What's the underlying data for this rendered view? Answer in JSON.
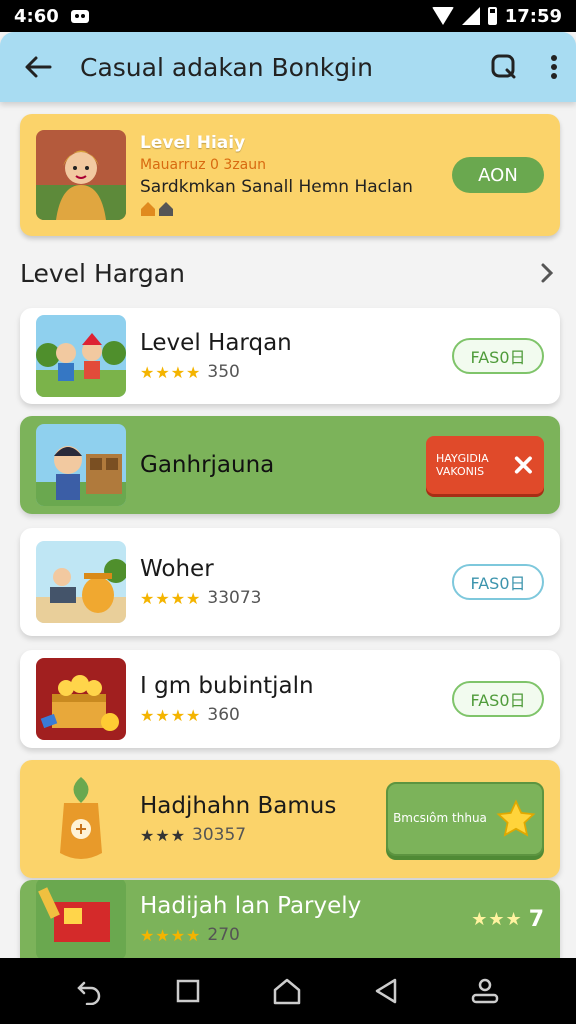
{
  "status_bar": {
    "time_left": "4:60",
    "time_right": "17:59"
  },
  "app_bar": {
    "title": "Casual adakan Bonkgin"
  },
  "banner": {
    "title": "Level Hiaiy",
    "subtitle": "Mauarruz 0 3zaun",
    "description": "Sardkmkan Sanall Hemn Haclan",
    "button_label": "AON"
  },
  "section": {
    "title": "Level Hargan"
  },
  "items": [
    {
      "name": "Level Harqan",
      "stars": "★★★★",
      "count": "350",
      "button_label": "FAS0日"
    },
    {
      "name": "Ganhrjauna",
      "button_label": "HAYGIDIA VAKONIS"
    },
    {
      "name": "Woher",
      "stars": "★★★★",
      "count": "33073",
      "button_label": "FAS0日"
    },
    {
      "name": "I gm bubintjaln",
      "stars": "★★★★",
      "count": "360",
      "button_label": "FAS0日"
    },
    {
      "name": "Hadjhahn Bamus",
      "stars": "★★★",
      "count": "30357",
      "button_label": "Bmcsıôm thhua"
    },
    {
      "name": "Hadijah lan Paryely",
      "stars": "★★★★",
      "count": "270",
      "rating": "7"
    }
  ],
  "colors": {
    "accent_blue": "#a8dcf2",
    "yellow": "#fbd36a",
    "green": "#7cb35a",
    "red": "#e04a2a"
  }
}
